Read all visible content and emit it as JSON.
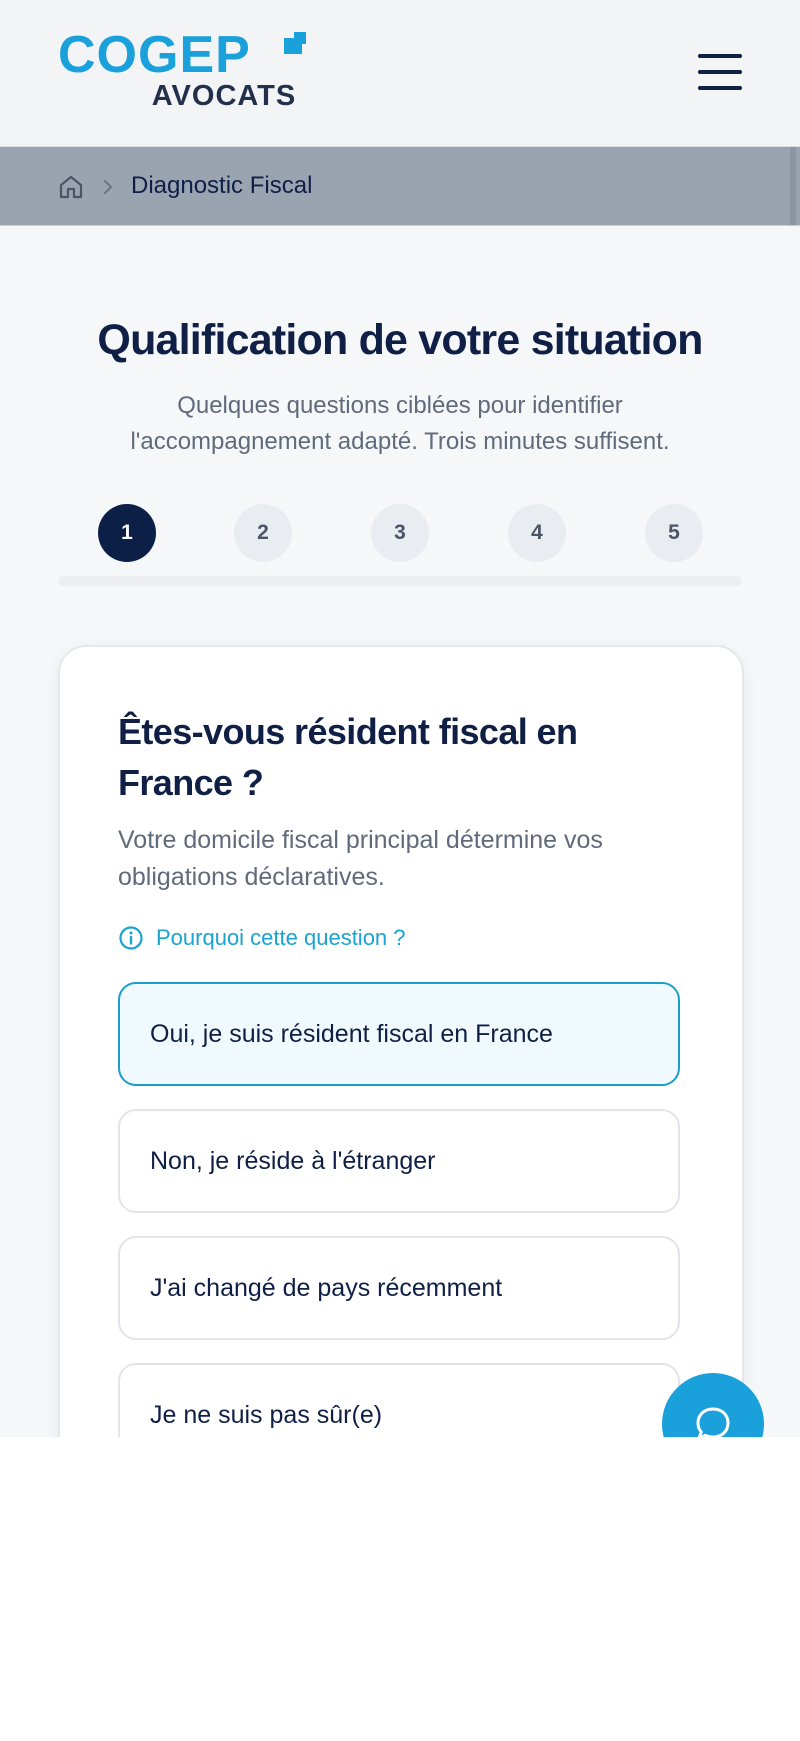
{
  "brand": {
    "logo_main": "COGEP",
    "logo_sub": "AVOCATS",
    "accent": "#1aa1db",
    "navy": "#0f1f45"
  },
  "header": {
    "menu_icon": "hamburger-menu-icon"
  },
  "breadcrumb": {
    "home_icon": "home-icon",
    "separator_icon": "chevron-right-icon",
    "current": "Diagnostic Fiscal"
  },
  "hero": {
    "title": "Qualification de votre situation",
    "subtitle": "Quelques questions ciblées pour identifier l'accompagnement adapté. Trois minutes suffisent."
  },
  "stepper": {
    "steps": [
      "1",
      "2",
      "3",
      "4",
      "5"
    ],
    "current_step": 1
  },
  "question": {
    "title": "Êtes-vous résident fiscal en France ?",
    "description": "Votre domicile fiscal principal détermine vos obligations déclaratives.",
    "help_icon": "info-icon",
    "help_label": "Pourquoi cette question ?",
    "options": [
      {
        "label": "Oui, je suis résident fiscal en France",
        "selected": true
      },
      {
        "label": "Non, je réside à l'étranger",
        "selected": false
      },
      {
        "label": "J'ai changé de pays récemment",
        "selected": false
      },
      {
        "label": "Je ne suis pas sûr(e)",
        "selected": false
      }
    ]
  },
  "chat": {
    "icon": "chat-bubble-icon"
  }
}
